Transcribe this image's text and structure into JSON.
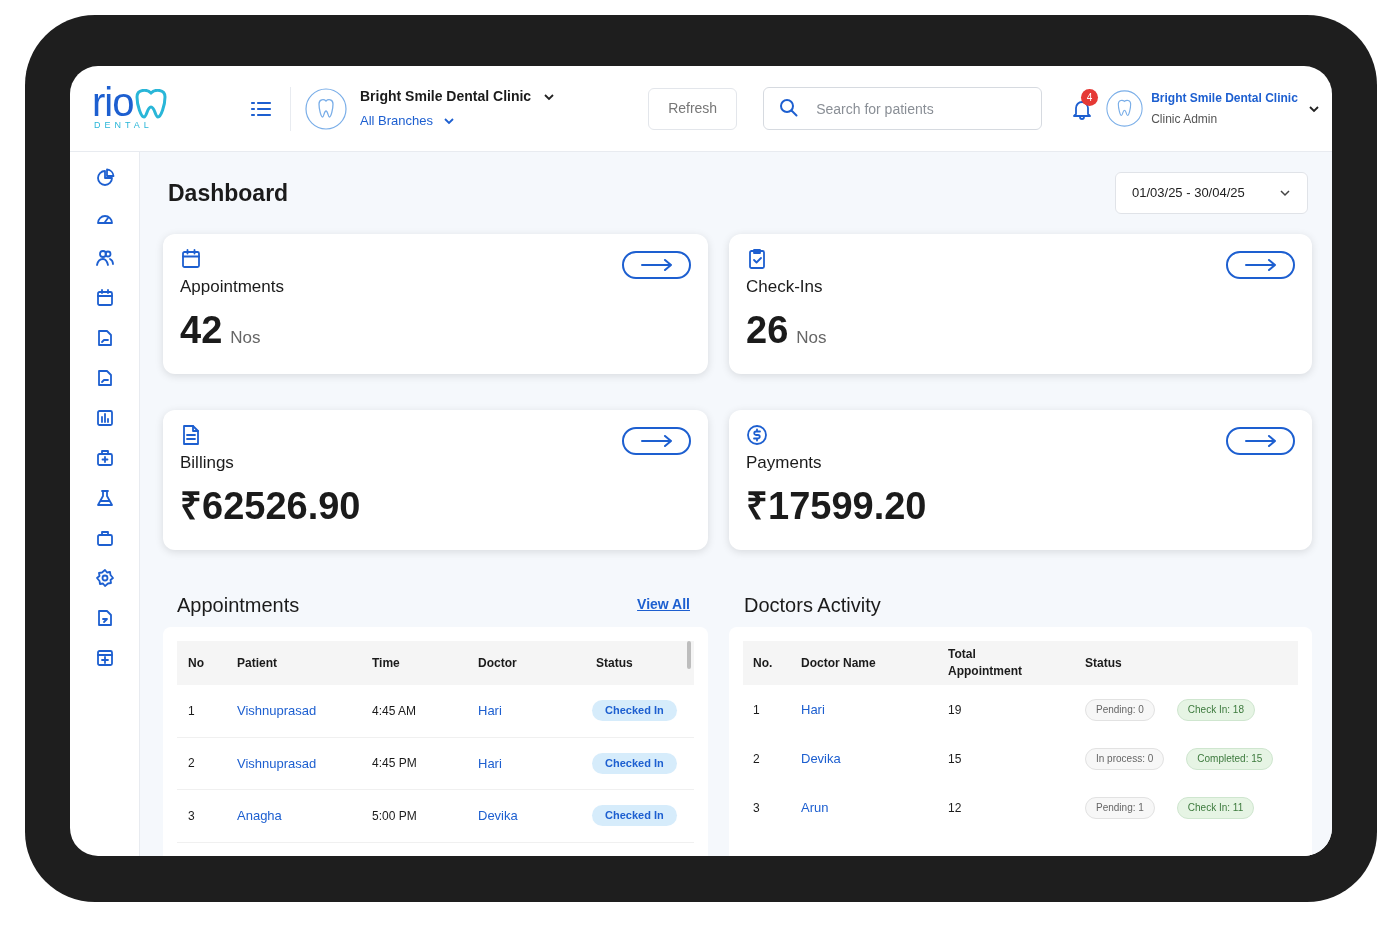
{
  "logo": {
    "text": "rio",
    "subtitle": "DENTAL"
  },
  "header": {
    "clinic_name": "Bright Smile Dental Clinic",
    "branch": "All Branches",
    "refresh_button": "Refresh",
    "search": {
      "placeholder": "Search for patients"
    },
    "notification_count": "4",
    "user": {
      "name": "Bright Smile Dental Clinic",
      "role": "Clinic Admin"
    }
  },
  "page_title": "Dashboard",
  "date_range": "01/03/25 - 30/04/25",
  "stat_cards": [
    {
      "kind": "calendar",
      "label": "Appointments",
      "value": "42",
      "unit": "Nos"
    },
    {
      "kind": "checklist",
      "label": "Check-Ins",
      "value": "26",
      "unit": "Nos"
    },
    {
      "kind": "invoice",
      "label": "Billings",
      "value": "₹62526.90"
    },
    {
      "kind": "payment",
      "label": "Payments",
      "value": "₹17599.20"
    }
  ],
  "appointments": {
    "title": "Appointments",
    "view_all": "View All",
    "columns": [
      "No",
      "Patient",
      "Time",
      "Doctor",
      "Status"
    ],
    "rows": [
      {
        "no": "1",
        "patient": "Vishnuprasad",
        "time": "4:45 AM",
        "doctor": "Hari",
        "status": "Checked In"
      },
      {
        "no": "2",
        "patient": "Vishnuprasad",
        "time": "4:45 PM",
        "doctor": "Hari",
        "status": "Checked In"
      },
      {
        "no": "3",
        "patient": "Anagha",
        "time": "5:00 PM",
        "doctor": "Devika",
        "status": "Checked In"
      }
    ]
  },
  "doctors_activity": {
    "title": "Doctors Activity",
    "columns": [
      "No.",
      "Doctor Name",
      "Total Appointment",
      "Status"
    ],
    "rows": [
      {
        "no": "1",
        "doctor": "Hari",
        "total": "19",
        "statuses": [
          {
            "kind": "neutral",
            "text": "Pending: 0"
          },
          {
            "kind": "success",
            "text": "Check In: 18"
          }
        ]
      },
      {
        "no": "2",
        "doctor": "Devika",
        "total": "15",
        "statuses": [
          {
            "kind": "neutral",
            "text": "In process: 0"
          },
          {
            "kind": "success",
            "text": "Completed: 15"
          }
        ]
      },
      {
        "no": "3",
        "doctor": "Arun",
        "total": "12",
        "statuses": [
          {
            "kind": "neutral",
            "text": "Pending: 1"
          },
          {
            "kind": "success",
            "text": "Check In: 11"
          }
        ]
      }
    ]
  }
}
